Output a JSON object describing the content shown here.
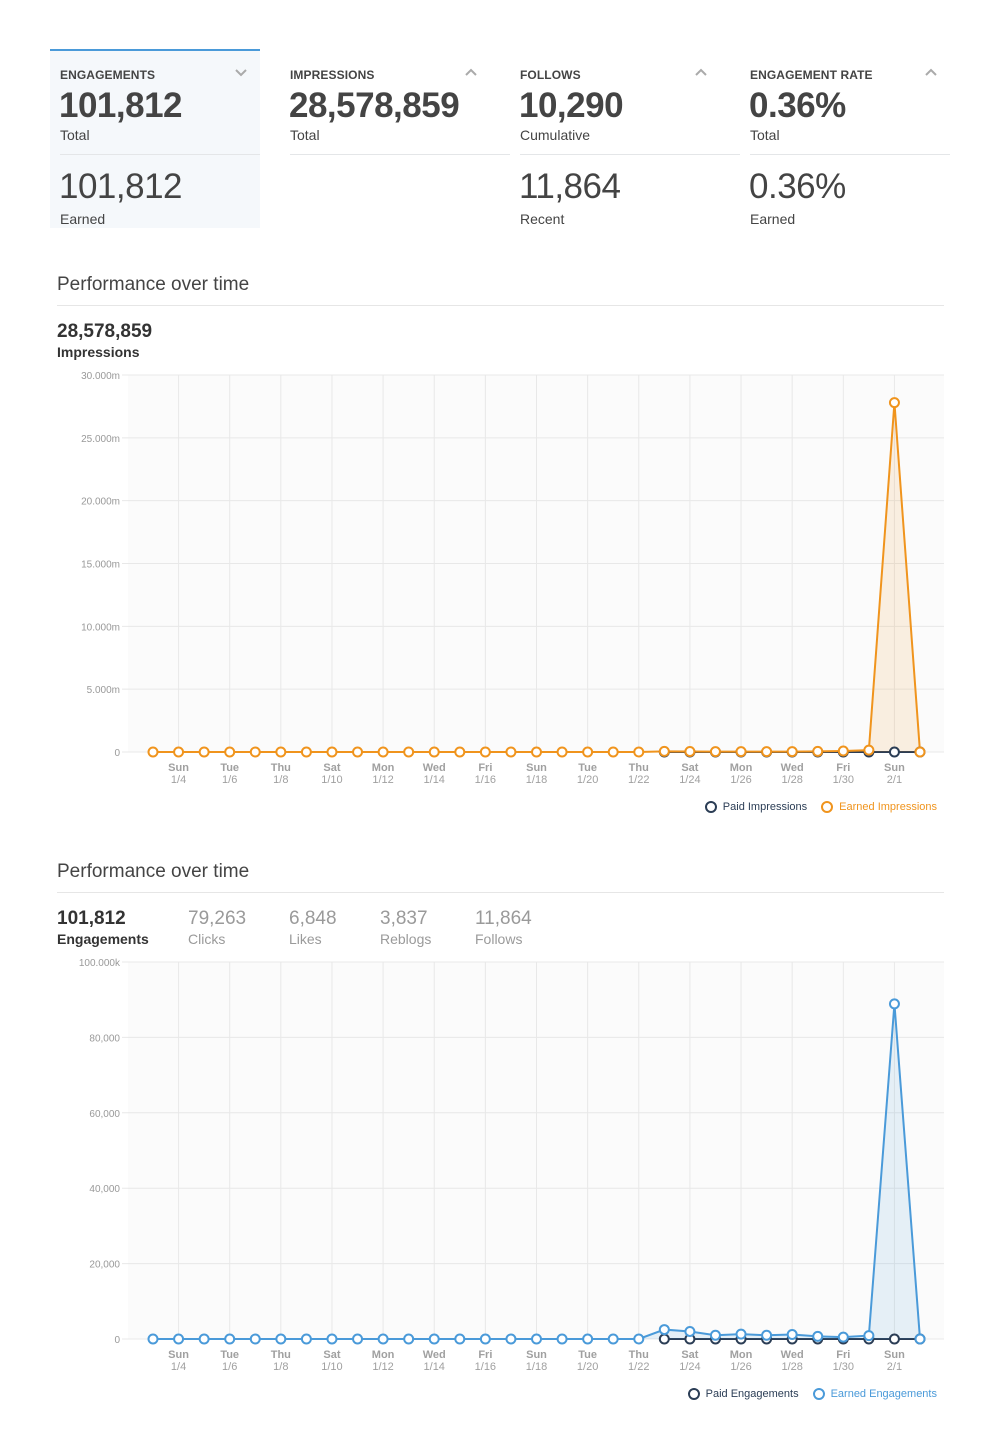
{
  "cards": [
    {
      "title": "ENGAGEMENTS",
      "chevron": "chevron-down-icon",
      "value1": "101,812",
      "label1": "Total",
      "value2": "101,812",
      "label2": "Earned",
      "active": true
    },
    {
      "title": "IMPRESSIONS",
      "chevron": "chevron-up-icon",
      "value1": "28,578,859",
      "label1": "Total",
      "value2": "",
      "label2": "",
      "active": false
    },
    {
      "title": "FOLLOWS",
      "chevron": "chevron-up-icon",
      "value1": "10,290",
      "label1": "Cumulative",
      "value2": "11,864",
      "label2": "Recent",
      "active": false
    },
    {
      "title": "ENGAGEMENT RATE",
      "chevron": "chevron-up-icon",
      "value1": "0.36%",
      "label1": "Total",
      "value2": "0.36%",
      "label2": "Earned",
      "active": false
    }
  ],
  "impressions_section": {
    "title": "Performance over time",
    "kpi_value": "28,578,859",
    "kpi_label": "Impressions"
  },
  "engagements_section": {
    "title": "Performance over time",
    "kpis": [
      {
        "value": "101,812",
        "label": "Engagements",
        "primary": true
      },
      {
        "value": "79,263",
        "label": "Clicks",
        "primary": false
      },
      {
        "value": "6,848",
        "label": "Likes",
        "primary": false
      },
      {
        "value": "3,837",
        "label": "Reblogs",
        "primary": false
      },
      {
        "value": "11,864",
        "label": "Follows",
        "primary": false
      }
    ]
  },
  "colors": {
    "accent": "#4a9ad9",
    "earned_impressions": "#f0941d",
    "earned_engagements": "#4a9ad9",
    "paid": "#2b3d55",
    "grid": "#e8e8e8",
    "plot_bg": "#fbfbfb"
  },
  "chart_data": [
    {
      "type": "line",
      "title": "Impressions",
      "x": [
        "1/3",
        "1/4",
        "1/5",
        "1/6",
        "1/7",
        "1/8",
        "1/9",
        "1/10",
        "1/11",
        "1/12",
        "1/13",
        "1/14",
        "1/15",
        "1/16",
        "1/17",
        "1/18",
        "1/19",
        "1/20",
        "1/21",
        "1/22",
        "1/23",
        "1/24",
        "1/25",
        "1/26",
        "1/27",
        "1/28",
        "1/29",
        "1/30",
        "1/31",
        "2/1",
        "2/2"
      ],
      "x_tick_labels": [
        {
          "day": "Sun",
          "date": "1/4"
        },
        {
          "day": "Tue",
          "date": "1/6"
        },
        {
          "day": "Thu",
          "date": "1/8"
        },
        {
          "day": "Sat",
          "date": "1/10"
        },
        {
          "day": "Mon",
          "date": "1/12"
        },
        {
          "day": "Wed",
          "date": "1/14"
        },
        {
          "day": "Fri",
          "date": "1/16"
        },
        {
          "day": "Sun",
          "date": "1/18"
        },
        {
          "day": "Tue",
          "date": "1/20"
        },
        {
          "day": "Thu",
          "date": "1/22"
        },
        {
          "day": "Sat",
          "date": "1/24"
        },
        {
          "day": "Mon",
          "date": "1/26"
        },
        {
          "day": "Wed",
          "date": "1/28"
        },
        {
          "day": "Fri",
          "date": "1/30"
        },
        {
          "day": "Sun",
          "date": "2/1"
        }
      ],
      "y_ticks": [
        "0",
        "5.000m",
        "10.000m",
        "15.000m",
        "20.000m",
        "25.000m",
        "30.000m"
      ],
      "ylim": [
        0,
        30000000
      ],
      "grid": true,
      "legend_position": "bottom-right",
      "series": [
        {
          "name": "Paid Impressions",
          "color": "#2b3d55",
          "start_index": 20,
          "values": [
            null,
            null,
            null,
            null,
            null,
            null,
            null,
            null,
            null,
            null,
            null,
            null,
            null,
            null,
            null,
            null,
            null,
            null,
            null,
            null,
            0,
            0,
            0,
            0,
            0,
            0,
            0,
            0,
            0,
            0,
            0
          ]
        },
        {
          "name": "Earned Impressions",
          "color": "#f0941d",
          "fill": true,
          "values": [
            0,
            0,
            0,
            0,
            0,
            0,
            0,
            0,
            0,
            0,
            0,
            0,
            0,
            0,
            0,
            0,
            0,
            0,
            0,
            0,
            50000,
            40000,
            30000,
            30000,
            30000,
            30000,
            50000,
            80000,
            150000,
            27800000,
            0
          ]
        }
      ]
    },
    {
      "type": "line",
      "title": "Engagements",
      "x": [
        "1/3",
        "1/4",
        "1/5",
        "1/6",
        "1/7",
        "1/8",
        "1/9",
        "1/10",
        "1/11",
        "1/12",
        "1/13",
        "1/14",
        "1/15",
        "1/16",
        "1/17",
        "1/18",
        "1/19",
        "1/20",
        "1/21",
        "1/22",
        "1/23",
        "1/24",
        "1/25",
        "1/26",
        "1/27",
        "1/28",
        "1/29",
        "1/30",
        "1/31",
        "2/1",
        "2/2"
      ],
      "x_tick_labels": [
        {
          "day": "Sun",
          "date": "1/4"
        },
        {
          "day": "Tue",
          "date": "1/6"
        },
        {
          "day": "Thu",
          "date": "1/8"
        },
        {
          "day": "Sat",
          "date": "1/10"
        },
        {
          "day": "Mon",
          "date": "1/12"
        },
        {
          "day": "Wed",
          "date": "1/14"
        },
        {
          "day": "Fri",
          "date": "1/16"
        },
        {
          "day": "Sun",
          "date": "1/18"
        },
        {
          "day": "Tue",
          "date": "1/20"
        },
        {
          "day": "Thu",
          "date": "1/22"
        },
        {
          "day": "Sat",
          "date": "1/24"
        },
        {
          "day": "Mon",
          "date": "1/26"
        },
        {
          "day": "Wed",
          "date": "1/28"
        },
        {
          "day": "Fri",
          "date": "1/30"
        },
        {
          "day": "Sun",
          "date": "2/1"
        }
      ],
      "y_ticks": [
        "0",
        "20,000",
        "40,000",
        "60,000",
        "80,000",
        "100.000k"
      ],
      "ylim": [
        0,
        100000
      ],
      "grid": true,
      "legend_position": "bottom-right",
      "series": [
        {
          "name": "Paid Engagements",
          "color": "#2b3d55",
          "values": [
            null,
            null,
            null,
            null,
            null,
            null,
            null,
            null,
            null,
            null,
            null,
            null,
            null,
            null,
            null,
            null,
            null,
            null,
            null,
            null,
            0,
            0,
            0,
            0,
            0,
            0,
            0,
            0,
            0,
            0,
            0
          ]
        },
        {
          "name": "Earned Engagements",
          "color": "#4a9ad9",
          "fill": true,
          "values": [
            0,
            0,
            0,
            0,
            0,
            0,
            0,
            0,
            0,
            0,
            0,
            0,
            0,
            0,
            0,
            0,
            0,
            0,
            0,
            0,
            2500,
            2000,
            1000,
            1300,
            1000,
            1200,
            700,
            500,
            900,
            88900,
            0
          ]
        }
      ]
    }
  ]
}
